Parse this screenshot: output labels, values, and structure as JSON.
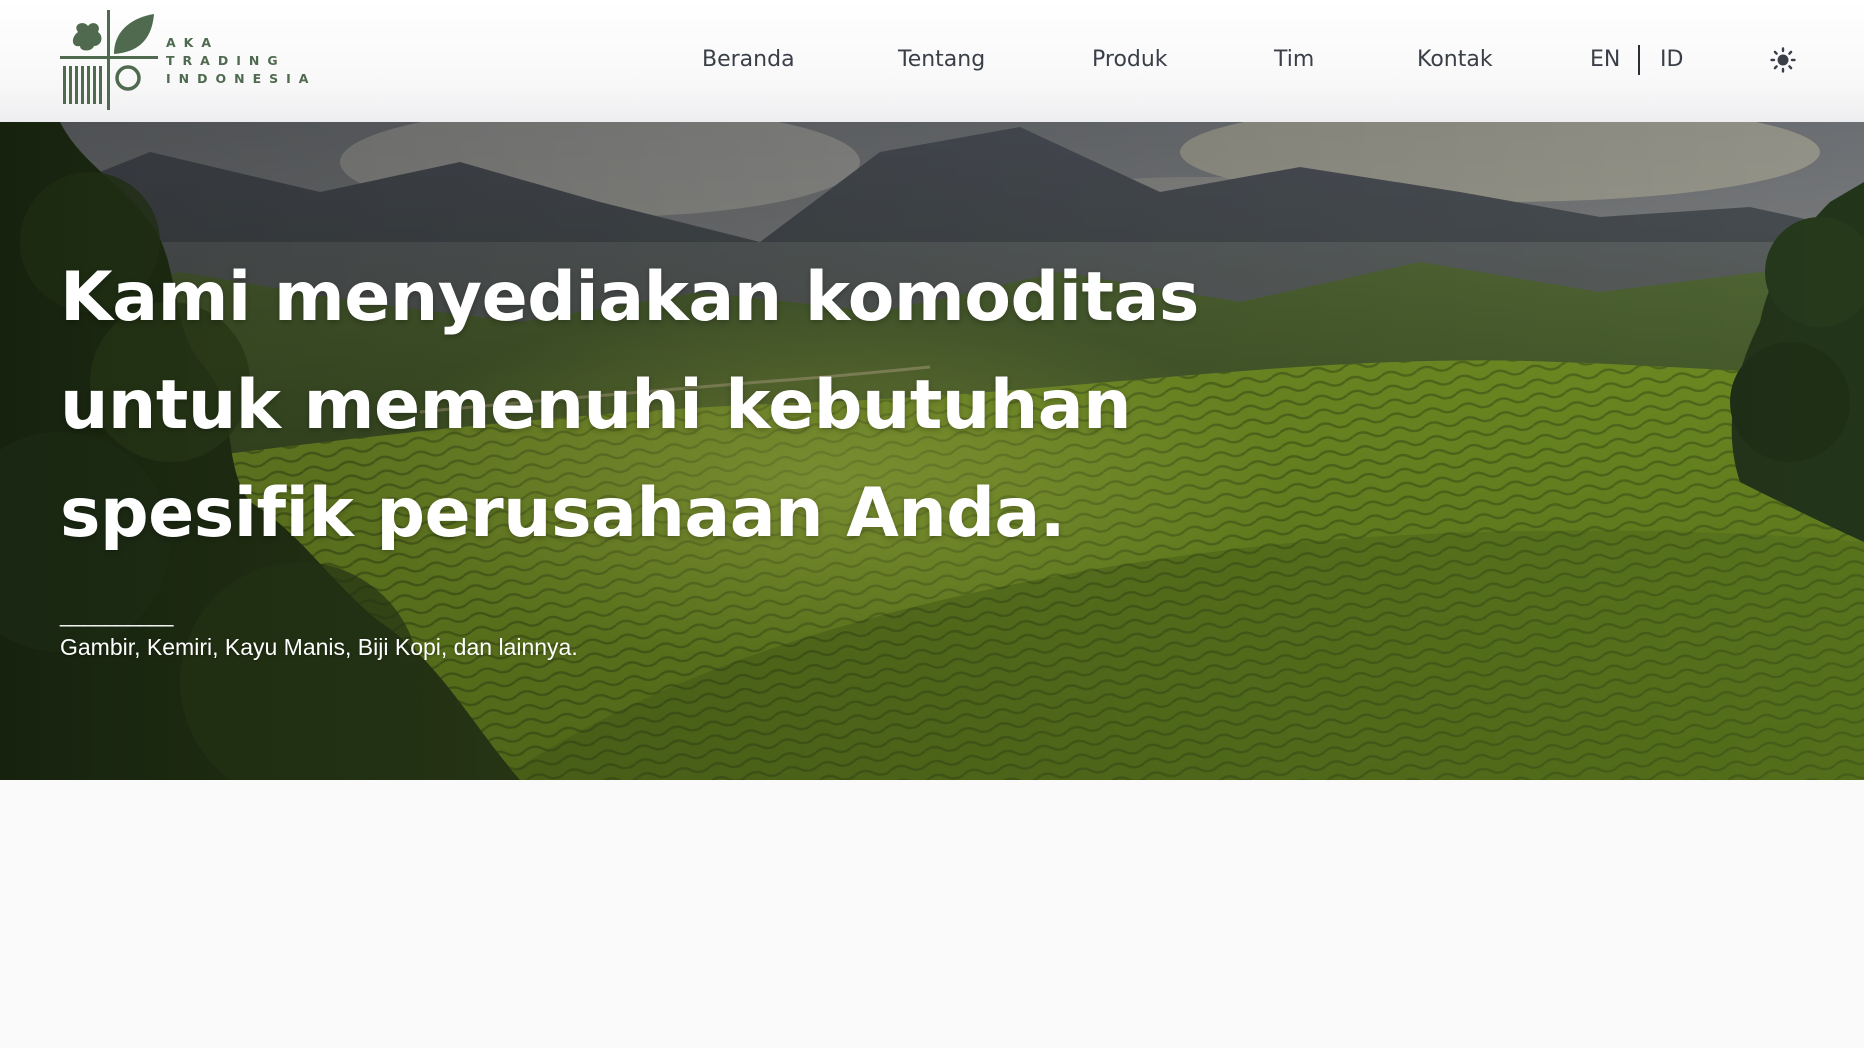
{
  "brand": {
    "line1": "AKA",
    "line2": "TRADING",
    "line3": "INDONESIA",
    "color": "#4f6a4f",
    "icon": "aka-trading-logo-icon"
  },
  "nav": {
    "items": [
      {
        "label": "Beranda"
      },
      {
        "label": "Tentang"
      },
      {
        "label": "Produk"
      },
      {
        "label": "Tim"
      },
      {
        "label": "Kontak"
      }
    ],
    "lang_en": "EN",
    "lang_id": "ID",
    "theme_icon": "sun-icon"
  },
  "hero": {
    "title": "Kami menyediakan komoditas untuk memenuhi kebutuhan spesifik perusahaan Anda.",
    "divider": "__________",
    "subtitle": "Gambir, Kemiri, Kayu Manis, Biji Kopi, dan lainnya.",
    "background": "tea-plantation-hills-image"
  },
  "colors": {
    "header_bg": "#fafafa",
    "nav_text": "#3a3f47",
    "hero_text": "#ffffff",
    "page_bg": "#fafafa"
  }
}
